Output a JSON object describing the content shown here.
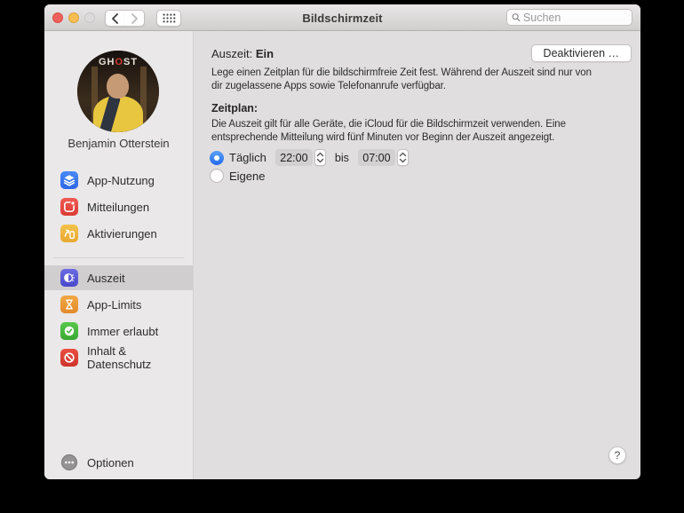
{
  "window": {
    "title": "Bildschirmzeit",
    "search_placeholder": "Suchen",
    "traffic_colors": {
      "close": "#f0605a",
      "minimize": "#f6be50",
      "zoom_disabled": "#dcdadb"
    }
  },
  "sidebar": {
    "user_name": "Benjamin Otterstein",
    "avatar_sign_prefix": "GH",
    "avatar_sign_o": "O",
    "avatar_sign_suffix": "ST",
    "items": [
      {
        "label": "App-Nutzung",
        "icon": "layers-icon",
        "color": "#2f6fe8",
        "selected": false
      },
      {
        "label": "Mitteilungen",
        "icon": "notification-badge-icon",
        "color": "#e0423c",
        "selected": false
      },
      {
        "label": "Aktivierungen",
        "icon": "device-pickup-icon",
        "color": "#eeb23e",
        "selected": false
      },
      {
        "label": "Auszeit",
        "icon": "downtime-clock-icon",
        "color": "#5a5dd6",
        "selected": true
      },
      {
        "label": "App-Limits",
        "icon": "hourglass-icon",
        "color": "#e9973b",
        "selected": false
      },
      {
        "label": "Immer erlaubt",
        "icon": "seal-check-icon",
        "color": "#46b93e",
        "selected": false
      },
      {
        "label": "Inhalt & Datenschutz",
        "icon": "prohibition-icon",
        "color": "#dc443a",
        "selected": false
      }
    ],
    "options_label": "Optionen"
  },
  "content": {
    "status_label": "Auszeit:",
    "status_value": "Ein",
    "deactivate_button": "Deaktivieren …",
    "intro_text": "Lege einen Zeitplan für die bildschirmfreie Zeit fest. Während der Auszeit sind nur von dir zugelassene Apps sowie Telefonanrufe verfügbar.",
    "schedule_heading": "Zeitplan:",
    "schedule_text": "Die Auszeit gilt für alle Geräte, die iCloud für die Bildschirmzeit verwenden. Eine entsprechende Mitteilung wird fünf Minuten vor Beginn der Auszeit angezeigt.",
    "radio_daily_label": "Täglich",
    "radio_custom_label": "Eigene",
    "time_from": "22:00",
    "time_between_label": "bis",
    "time_to": "07:00",
    "help_label": "?",
    "accent_color": "#2a7af2"
  }
}
